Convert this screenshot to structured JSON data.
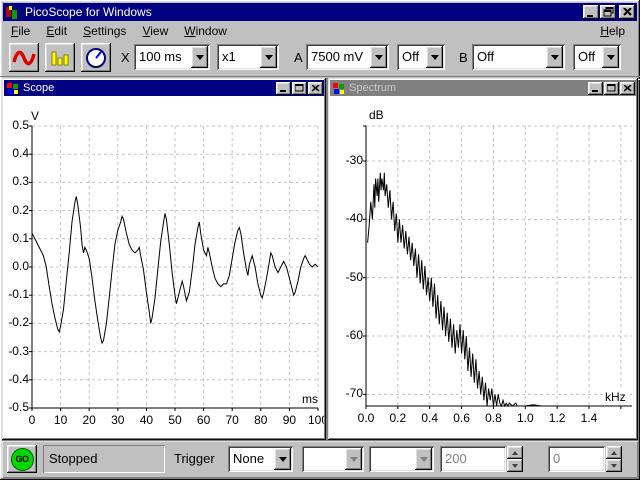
{
  "window": {
    "title": "PicoScope for Windows"
  },
  "menu": {
    "items": [
      "File",
      "Edit",
      "Settings",
      "View",
      "Window"
    ],
    "help": "Help"
  },
  "toolbar": {
    "icons": [
      "scope-view-icon",
      "spectrum-view-icon",
      "meter-view-icon"
    ],
    "x_label": "X",
    "timebase": "100 ms",
    "multiplier": "x1",
    "a_label": "A",
    "a_range": "7500 mV",
    "a_mode": "Off",
    "b_label": "B",
    "b_range": "Off",
    "b_mode": "Off"
  },
  "scope_window": {
    "title": "Scope"
  },
  "spectrum_window": {
    "title": "Spectrum"
  },
  "statusbar": {
    "go_label": "GO",
    "status": "Stopped",
    "trigger_label": "Trigger",
    "trigger_mode": "None",
    "field1": "",
    "field2": "",
    "samples": "200",
    "delay": "0"
  },
  "chart_data": [
    {
      "type": "line",
      "title": "Scope",
      "ylabel": "V",
      "xlabel": "ms",
      "xlim": [
        0,
        100
      ],
      "ylim": [
        -0.5,
        0.5
      ],
      "grid": true,
      "xticks": [
        0,
        10,
        20,
        30,
        40,
        50,
        60,
        70,
        80,
        90,
        100
      ],
      "xtick_labels": [
        "0",
        "10",
        "20",
        "30",
        "40",
        "50",
        "60",
        "70",
        "80",
        "90",
        "100"
      ],
      "yticks": [
        0.5,
        0.4,
        0.3,
        0.2,
        0.1,
        0.0,
        -0.1,
        -0.2,
        -0.3,
        -0.4,
        -0.5
      ],
      "ytick_labels": [
        "0.5",
        "0.4",
        "0.3",
        "0.2",
        "0.1",
        "0.0",
        "-0.1",
        "-0.2",
        "-0.3",
        "-0.4",
        "-0.5"
      ],
      "points": [
        [
          0,
          0.12
        ],
        [
          1,
          0.1
        ],
        [
          2,
          0.08
        ],
        [
          3,
          0.06
        ],
        [
          3.5,
          0.05
        ],
        [
          4,
          0.04
        ],
        [
          5,
          0.0
        ],
        [
          6,
          -0.07
        ],
        [
          7,
          -0.13
        ],
        [
          8,
          -0.18
        ],
        [
          9,
          -0.22
        ],
        [
          9.5,
          -0.23
        ],
        [
          10,
          -0.21
        ],
        [
          11,
          -0.15
        ],
        [
          12,
          -0.05
        ],
        [
          13,
          0.05
        ],
        [
          14,
          0.16
        ],
        [
          15,
          0.23
        ],
        [
          15.5,
          0.25
        ],
        [
          16,
          0.22
        ],
        [
          17,
          0.14
        ],
        [
          17.5,
          0.08
        ],
        [
          18,
          0.05
        ],
        [
          18.5,
          0.07
        ],
        [
          19,
          0.06
        ],
        [
          20,
          0.03
        ],
        [
          21,
          -0.04
        ],
        [
          22,
          -0.12
        ],
        [
          23,
          -0.19
        ],
        [
          24,
          -0.25
        ],
        [
          24.5,
          -0.27
        ],
        [
          25,
          -0.26
        ],
        [
          26,
          -0.2
        ],
        [
          27,
          -0.11
        ],
        [
          28,
          -0.01
        ],
        [
          29,
          0.08
        ],
        [
          30,
          0.13
        ],
        [
          31,
          0.16
        ],
        [
          31.5,
          0.18
        ],
        [
          32,
          0.17
        ],
        [
          33,
          0.12
        ],
        [
          34,
          0.08
        ],
        [
          35,
          0.06
        ],
        [
          36,
          0.05
        ],
        [
          37,
          0.06
        ],
        [
          37.5,
          0.07
        ],
        [
          38,
          0.04
        ],
        [
          39,
          -0.01
        ],
        [
          40,
          -0.09
        ],
        [
          41,
          -0.16
        ],
        [
          41.5,
          -0.2
        ],
        [
          42,
          -0.18
        ],
        [
          43,
          -0.11
        ],
        [
          44,
          -0.01
        ],
        [
          45,
          0.09
        ],
        [
          46,
          0.16
        ],
        [
          46.5,
          0.19
        ],
        [
          47,
          0.17
        ],
        [
          48,
          0.08
        ],
        [
          49,
          -0.02
        ],
        [
          50,
          -0.1
        ],
        [
          50.5,
          -0.13
        ],
        [
          51,
          -0.11
        ],
        [
          52,
          -0.07
        ],
        [
          52.5,
          -0.05
        ],
        [
          53,
          -0.07
        ],
        [
          54,
          -0.12
        ],
        [
          55,
          -0.09
        ],
        [
          56,
          -0.01
        ],
        [
          57,
          0.08
        ],
        [
          58,
          0.14
        ],
        [
          58.5,
          0.16
        ],
        [
          59,
          0.12
        ],
        [
          60,
          0.06
        ],
        [
          61,
          0.04
        ],
        [
          61.5,
          0.07
        ],
        [
          62,
          0.05
        ],
        [
          63,
          0.0
        ],
        [
          64,
          -0.04
        ],
        [
          65,
          -0.06
        ],
        [
          66,
          -0.07
        ],
        [
          67,
          -0.06
        ],
        [
          68,
          -0.06
        ],
        [
          69,
          -0.03
        ],
        [
          70,
          0.03
        ],
        [
          71,
          0.09
        ],
        [
          72,
          0.13
        ],
        [
          72.5,
          0.14
        ],
        [
          73,
          0.12
        ],
        [
          74,
          0.05
        ],
        [
          75,
          -0.01
        ],
        [
          75.5,
          -0.03
        ],
        [
          76,
          0.01
        ],
        [
          77,
          0.04
        ],
        [
          78,
          0.0
        ],
        [
          79,
          -0.06
        ],
        [
          80,
          -0.1
        ],
        [
          80.5,
          -0.11
        ],
        [
          81,
          -0.09
        ],
        [
          82,
          -0.04
        ],
        [
          83,
          0.02
        ],
        [
          83.5,
          0.05
        ],
        [
          84,
          0.04
        ],
        [
          85,
          0.0
        ],
        [
          86,
          -0.02
        ],
        [
          87,
          0.0
        ],
        [
          88,
          0.02
        ],
        [
          89,
          0.0
        ],
        [
          90,
          -0.04
        ],
        [
          91,
          -0.08
        ],
        [
          91.5,
          -0.1
        ],
        [
          92,
          -0.09
        ],
        [
          93,
          -0.05
        ],
        [
          94,
          0.0
        ],
        [
          95,
          0.03
        ],
        [
          95.5,
          0.04
        ],
        [
          96,
          0.03
        ],
        [
          97,
          0.01
        ],
        [
          98,
          0.0
        ],
        [
          99,
          0.01
        ],
        [
          100,
          0.0
        ]
      ]
    },
    {
      "type": "line",
      "title": "Spectrum",
      "ylabel": "dB",
      "xlabel": "kHz",
      "xlim": [
        0,
        1.67
      ],
      "ylim": [
        -72,
        -24
      ],
      "grid": true,
      "xticks": [
        0,
        0.2,
        0.4,
        0.6,
        0.8,
        1.0,
        1.2,
        1.4,
        1.6
      ],
      "xtick_labels": [
        "0.0",
        "0.2",
        "0.4",
        "0.6",
        "0.8",
        "1.0",
        "1.2",
        "1.4",
        ""
      ],
      "yticks": [
        -24,
        -30,
        -40,
        -50,
        -60,
        -70
      ],
      "ytick_labels": [
        "",
        "-30",
        "-40",
        "-50",
        "-60",
        "-70"
      ],
      "points": [
        [
          0.01,
          -44
        ],
        [
          0.02,
          -41
        ],
        [
          0.03,
          -37
        ],
        [
          0.04,
          -40
        ],
        [
          0.05,
          -34
        ],
        [
          0.055,
          -38
        ],
        [
          0.06,
          -33
        ],
        [
          0.07,
          -36
        ],
        [
          0.075,
          -33
        ],
        [
          0.08,
          -37
        ],
        [
          0.09,
          -32
        ],
        [
          0.095,
          -35
        ],
        [
          0.1,
          -33
        ],
        [
          0.11,
          -35
        ],
        [
          0.115,
          -32
        ],
        [
          0.12,
          -36
        ],
        [
          0.13,
          -34
        ],
        [
          0.14,
          -38
        ],
        [
          0.15,
          -35
        ],
        [
          0.16,
          -40
        ],
        [
          0.17,
          -37
        ],
        [
          0.18,
          -42
        ],
        [
          0.19,
          -39
        ],
        [
          0.2,
          -44
        ],
        [
          0.21,
          -40
        ],
        [
          0.22,
          -44
        ],
        [
          0.23,
          -41
        ],
        [
          0.24,
          -45
        ],
        [
          0.25,
          -42
        ],
        [
          0.26,
          -46
        ],
        [
          0.27,
          -43
        ],
        [
          0.28,
          -47
        ],
        [
          0.29,
          -44
        ],
        [
          0.3,
          -48
        ],
        [
          0.31,
          -45
        ],
        [
          0.32,
          -50
        ],
        [
          0.33,
          -46
        ],
        [
          0.34,
          -51
        ],
        [
          0.35,
          -47
        ],
        [
          0.36,
          -52
        ],
        [
          0.37,
          -48
        ],
        [
          0.38,
          -53
        ],
        [
          0.39,
          -50
        ],
        [
          0.4,
          -54
        ],
        [
          0.41,
          -50
        ],
        [
          0.42,
          -55
        ],
        [
          0.43,
          -51
        ],
        [
          0.44,
          -57
        ],
        [
          0.45,
          -53
        ],
        [
          0.46,
          -58
        ],
        [
          0.47,
          -54
        ],
        [
          0.48,
          -59
        ],
        [
          0.49,
          -55
        ],
        [
          0.5,
          -60
        ],
        [
          0.51,
          -56
        ],
        [
          0.52,
          -61
        ],
        [
          0.53,
          -57
        ],
        [
          0.54,
          -62
        ],
        [
          0.55,
          -58
        ],
        [
          0.56,
          -63
        ],
        [
          0.57,
          -59
        ],
        [
          0.58,
          -62
        ],
        [
          0.59,
          -58
        ],
        [
          0.6,
          -63
        ],
        [
          0.61,
          -59
        ],
        [
          0.62,
          -64
        ],
        [
          0.63,
          -60
        ],
        [
          0.64,
          -66
        ],
        [
          0.65,
          -62
        ],
        [
          0.66,
          -67
        ],
        [
          0.67,
          -63
        ],
        [
          0.68,
          -68
        ],
        [
          0.69,
          -64
        ],
        [
          0.7,
          -69
        ],
        [
          0.71,
          -66
        ],
        [
          0.72,
          -70
        ],
        [
          0.73,
          -67
        ],
        [
          0.74,
          -71
        ],
        [
          0.75,
          -68
        ],
        [
          0.76,
          -72
        ],
        [
          0.77,
          -69
        ],
        [
          0.78,
          -71
        ],
        [
          0.79,
          -69
        ],
        [
          0.8,
          -72
        ],
        [
          0.81,
          -70
        ],
        [
          0.82,
          -72
        ],
        [
          0.83,
          -70
        ],
        [
          0.84,
          -71.5
        ],
        [
          0.85,
          -72
        ],
        [
          0.86,
          -71
        ],
        [
          0.87,
          -72
        ],
        [
          0.88,
          -71.5
        ],
        [
          0.89,
          -72
        ],
        [
          0.9,
          -71.5
        ],
        [
          0.92,
          -72
        ],
        [
          0.94,
          -71.5
        ],
        [
          0.95,
          -72
        ],
        [
          1.0,
          -72
        ],
        [
          1.05,
          -71.8
        ],
        [
          1.1,
          -72
        ],
        [
          1.2,
          -72
        ],
        [
          1.3,
          -72
        ],
        [
          1.4,
          -72
        ],
        [
          1.47,
          -72
        ]
      ]
    }
  ]
}
